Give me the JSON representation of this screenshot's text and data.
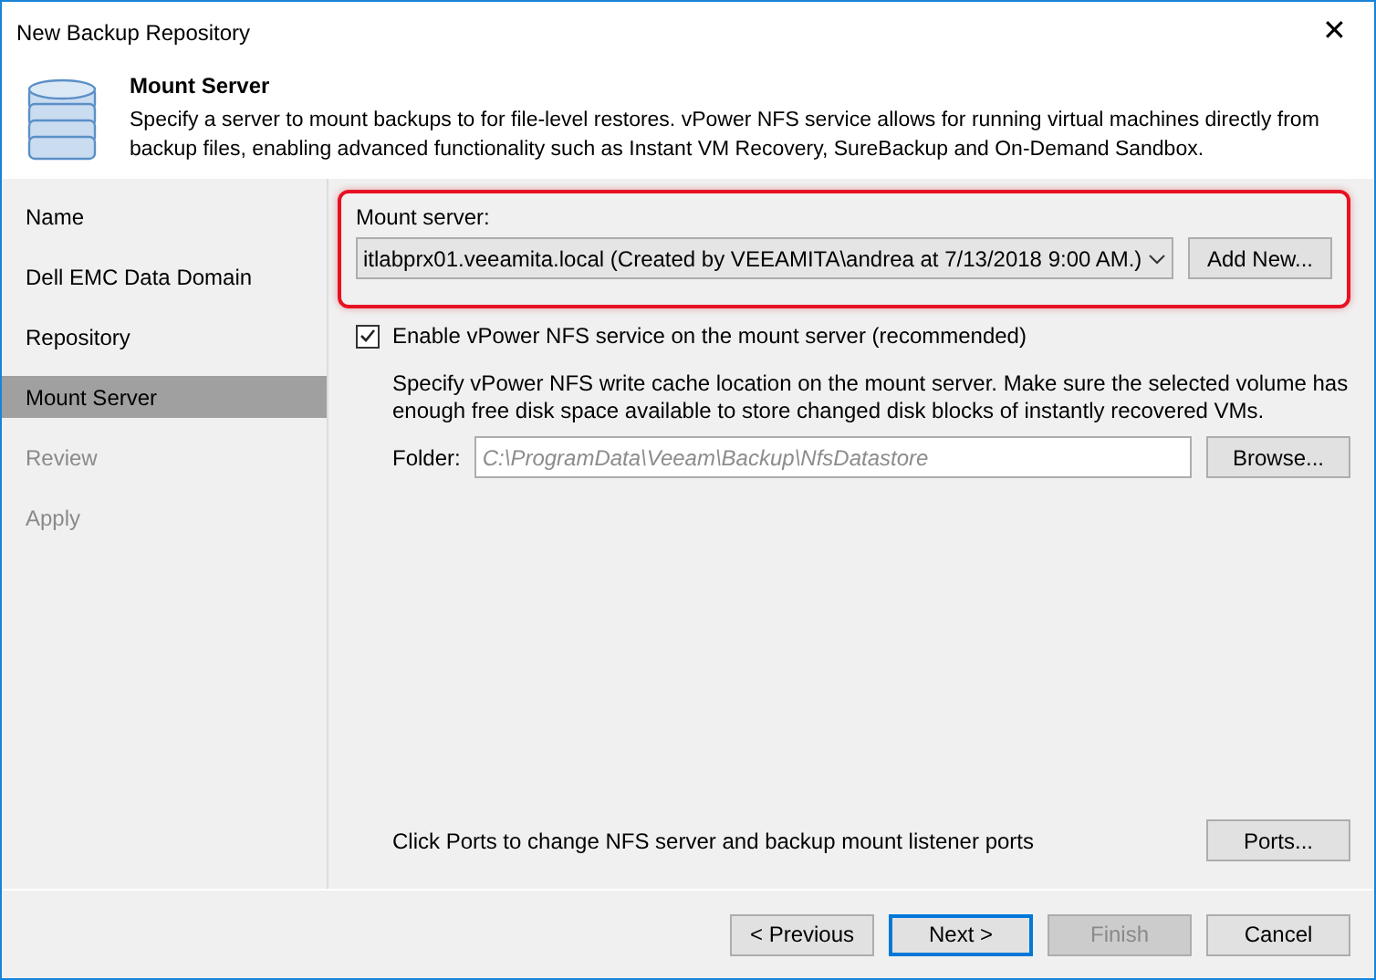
{
  "window": {
    "title": "New Backup Repository",
    "close": "✕"
  },
  "header": {
    "title": "Mount Server",
    "description": "Specify a server to mount backups to for file-level restores. vPower NFS service allows for running virtual machines directly from backup files, enabling advanced functionality such as Instant VM Recovery, SureBackup and On-Demand Sandbox."
  },
  "sidebar": {
    "items": [
      {
        "label": "Name",
        "selected": false,
        "disabled": false
      },
      {
        "label": "Dell EMC Data Domain",
        "selected": false,
        "disabled": false
      },
      {
        "label": "Repository",
        "selected": false,
        "disabled": false
      },
      {
        "label": "Mount Server",
        "selected": true,
        "disabled": false
      },
      {
        "label": "Review",
        "selected": false,
        "disabled": true
      },
      {
        "label": "Apply",
        "selected": false,
        "disabled": true
      }
    ]
  },
  "mount_server": {
    "label": "Mount server:",
    "value": "itlabprx01.veeamita.local (Created by VEEAMITA\\andrea at 7/13/2018 9:00 AM.)",
    "add_button": "Add New...",
    "highlighted": true
  },
  "nfs": {
    "label": "Enable vPower NFS service on the mount server (recommended)",
    "checked": true,
    "note": "Specify vPower NFS write cache location on the mount server. Make sure the selected volume has enough free disk space available to store changed disk blocks of instantly recovered VMs.",
    "folder_label": "Folder:",
    "folder_placeholder": "C:\\ProgramData\\Veeam\\Backup\\NfsDatastore",
    "browse_button": "Browse..."
  },
  "ports": {
    "text": "Click Ports to change NFS server and backup mount listener ports",
    "button": "Ports..."
  },
  "buttons": [
    {
      "label": "< Previous",
      "default": false,
      "disabled": false
    },
    {
      "label": "Next >",
      "default": true,
      "disabled": false
    },
    {
      "label": "Finish",
      "default": false,
      "disabled": true
    },
    {
      "label": "Cancel",
      "default": false,
      "disabled": false
    }
  ]
}
